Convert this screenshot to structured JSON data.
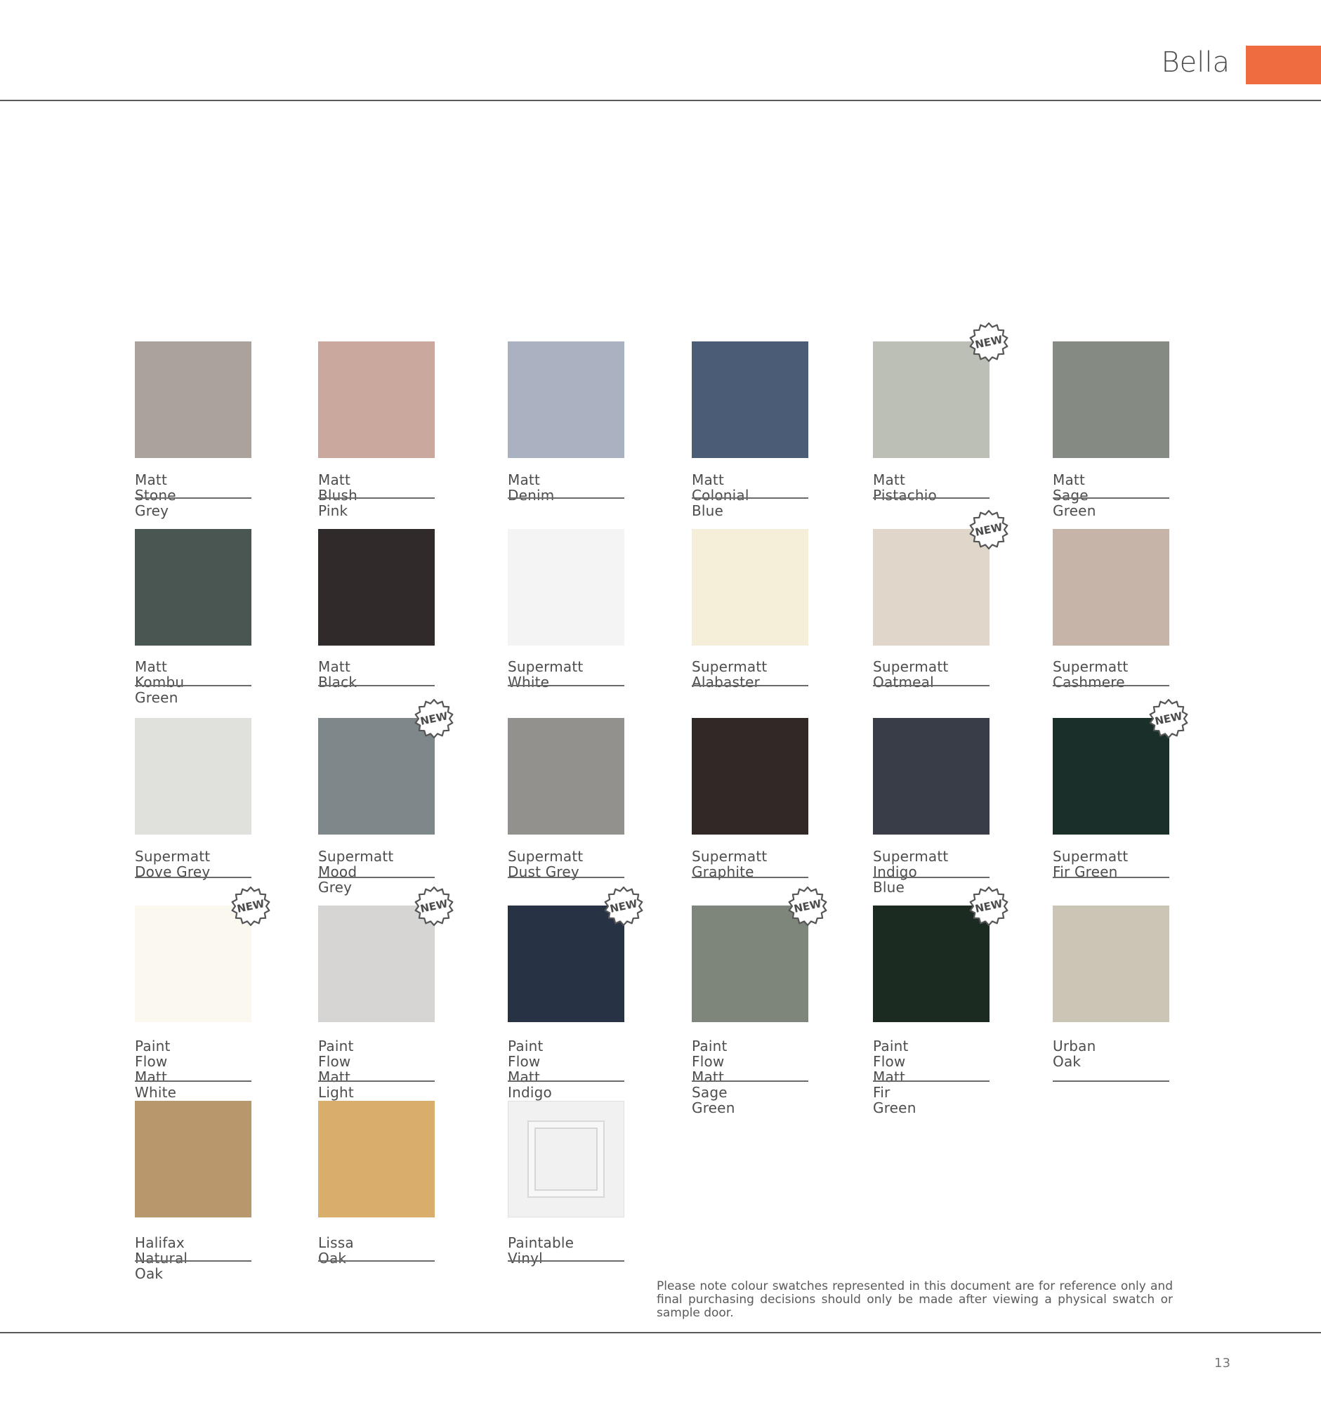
{
  "header": {
    "title": "Bella",
    "accent_color": "#ee6c40"
  },
  "badge_text": "NEW",
  "swatches": [
    {
      "label": "Matt Stone Grey",
      "color": "#aba39b",
      "new": false
    },
    {
      "label": "Matt Blush Pink",
      "color": "#cba89e",
      "new": false
    },
    {
      "label": "Matt Denim",
      "color": "#aab1c0",
      "new": false
    },
    {
      "label": "Matt Colonial Blue",
      "color": "#4b5c76",
      "new": false
    },
    {
      "label": "Matt Pistachio",
      "color": "#bbbfb6",
      "new": true
    },
    {
      "label": "Matt Sage Green",
      "color": "#858b82",
      "new": false
    },
    {
      "label": "Matt Kombu Green",
      "color": "#4a5652",
      "new": false
    },
    {
      "label": "Matt Black",
      "color": "#302a2a",
      "new": false
    },
    {
      "label": "Supermatt White",
      "color": "#f4f4f4",
      "new": false
    },
    {
      "label": "Supermatt Alabaster",
      "color": "#f5efda",
      "new": false
    },
    {
      "label": "Supermatt Oatmeal",
      "color": "#e0d6ca",
      "new": true
    },
    {
      "label": "Supermatt Cashmere",
      "color": "#c5b4a7",
      "new": false
    },
    {
      "label": "Supermatt Dove Grey",
      "color": "#e0e0dc",
      "new": false
    },
    {
      "label": "Supermatt Mood Grey",
      "color": "#7e888a",
      "new": true
    },
    {
      "label": "Supermatt Dust Grey",
      "color": "#93918e",
      "new": false
    },
    {
      "label": "Supermatt Graphite",
      "color": "#302926",
      "new": false
    },
    {
      "label": "Supermatt Indigo Blue",
      "color": "#393d48",
      "new": false
    },
    {
      "label": "Supermatt Fir Green",
      "color": "#1a2f2a",
      "new": true
    },
    {
      "label": "Paint Flow\nMatt\nWhite",
      "color": "#faf8ef",
      "new": true
    },
    {
      "label": "Paint Flow\nMatt Light Grey",
      "color": "#d7d5d3",
      "new": true
    },
    {
      "label": "Paint Flow\nMatt Indigo Blue",
      "color": "#273244",
      "new": true
    },
    {
      "label": "Paint Flow\nMatt Sage Green",
      "color": "#7e857a",
      "new": true
    },
    {
      "label": "Paint Flow\nMatt Fir Green",
      "color": "#1c2b22",
      "new": true
    },
    {
      "label": "Urban Oak",
      "color": "#cbc5b6",
      "new": false
    },
    {
      "label": "Halifax Natural Oak",
      "color": "#b9976c",
      "new": false
    },
    {
      "label": "Lissa Oak",
      "color": "#d9ae6a",
      "new": false
    },
    {
      "label": "Paintable Vinyl",
      "color": "#f1f1f1",
      "new": false
    }
  ],
  "disclaimer": "Please note colour swatches represented in this document are for reference only and final purchasing decisions should only be made after viewing a physical swatch or sample door.",
  "page_number": "13"
}
